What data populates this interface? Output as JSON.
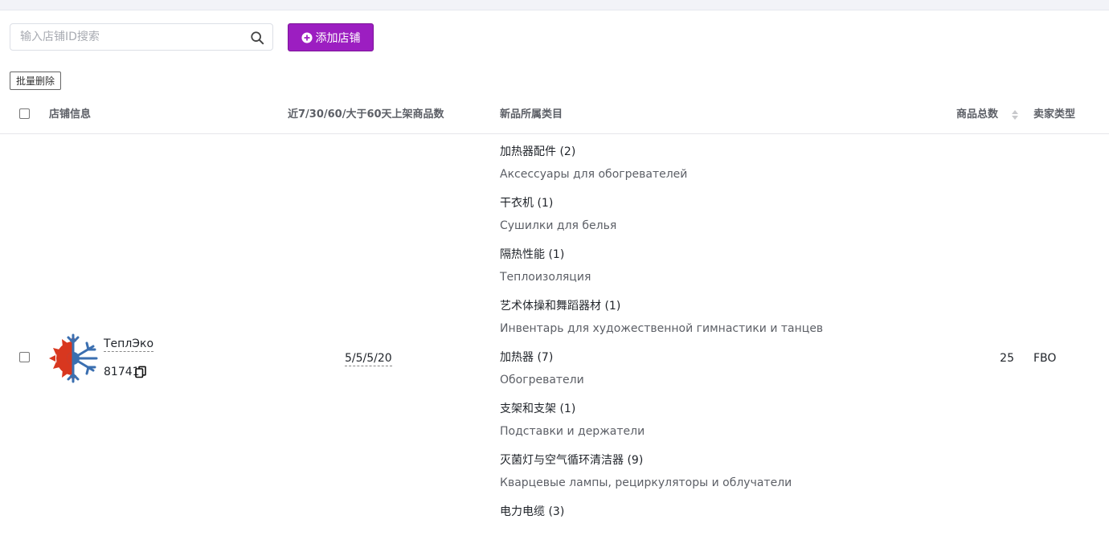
{
  "search": {
    "placeholder": "输入店铺ID搜索",
    "value": ""
  },
  "toolbar": {
    "add_label": "添加店铺",
    "bulk_delete_label": "批量删除"
  },
  "table": {
    "headers": {
      "shop_info": "店铺信息",
      "listings": "近7/30/60/大于60天上架商品数",
      "categories": "新品所属类目",
      "total": "商品总数",
      "seller_type": "卖家类型"
    },
    "rows": [
      {
        "shop_name": "ТеплЭко",
        "shop_id": "81741",
        "listing_counts": "5/5/5/20",
        "categories": [
          {
            "cn": "加热器配件 (2)",
            "ru": "Аксессуары для обогревателей"
          },
          {
            "cn": "干衣机 (1)",
            "ru": "Сушилки для белья"
          },
          {
            "cn": "隔热性能 (1)",
            "ru": "Теплоизоляция"
          },
          {
            "cn": "艺术体操和舞蹈器材 (1)",
            "ru": "Инвентарь для художественной гимнастики и танцев"
          },
          {
            "cn": "加热器 (7)",
            "ru": "Обогреватели"
          },
          {
            "cn": "支架和支架 (1)",
            "ru": "Подставки и держатели"
          },
          {
            "cn": "灭菌灯与空气循环清洁器 (9)",
            "ru": "Кварцевые лампы, рециркуляторы и облучатели"
          },
          {
            "cn": "电力电缆 (3)",
            "ru": ""
          }
        ],
        "total": "25",
        "seller_type": "FBO"
      }
    ]
  },
  "colors": {
    "accent": "#9c1ec1",
    "logo_red": "#d8371f",
    "logo_blue": "#3b6fb0"
  },
  "icons": {
    "search": "search-icon",
    "add": "plus-circle-icon",
    "copy": "copy-icon",
    "sort": "sort-icon"
  }
}
